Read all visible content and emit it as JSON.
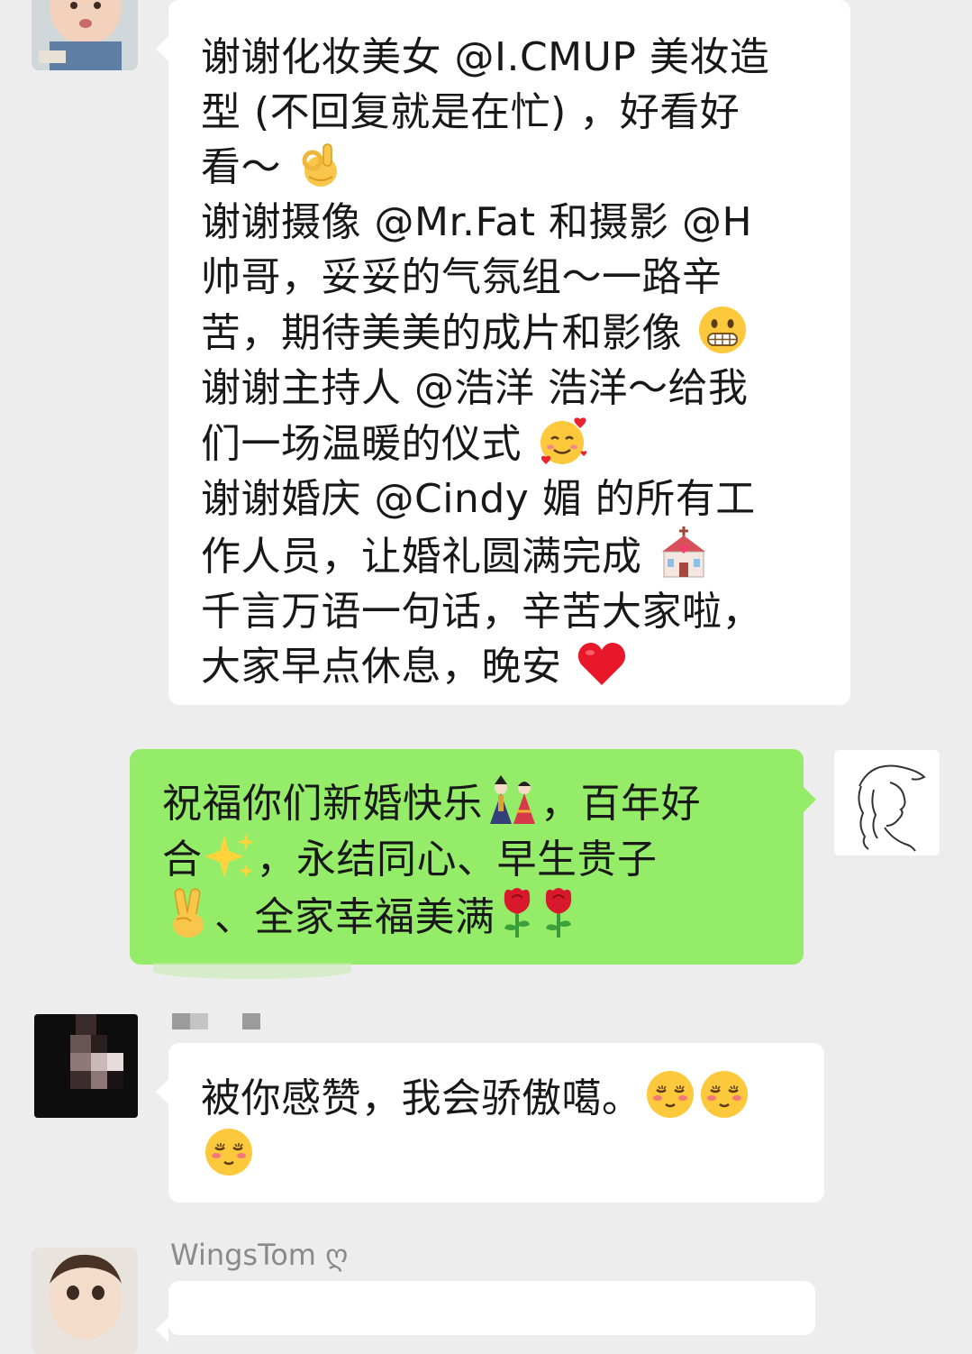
{
  "messages": [
    {
      "sender": "",
      "lines": [
        "谢谢化妆美女 @I.CMUP 美妆造",
        "型 (不回复就是在忙) ，好看好",
        "看～",
        "谢谢摄像 @Mr.Fat 和摄影 @H",
        "帅哥，妥妥的气氛组～一路辛",
        "苦，期待美美的成片和影像",
        "谢谢主持人 @浩洋 浩洋～给我",
        "们一场温暖的仪式",
        "谢谢婚庆 @Cindy 媚 的所有工",
        "作人员，让婚礼圆满完成",
        "千言万语一句话，辛苦大家啦，",
        "大家早点休息，晚安"
      ],
      "emojis": [
        "ok-hand-emoji",
        "grimacing-emoji",
        "smiling-hearts-emoji",
        "wedding-chapel-emoji",
        "red-heart-emoji"
      ]
    },
    {
      "sender": "me",
      "lines": [
        "祝福你们新婚快乐",
        "，百年好",
        "合",
        "，永结同心、早生贵子",
        "、全家幸福美满"
      ],
      "emojis": [
        "dolls-emoji",
        "sparkles-emoji",
        "victory-hand-emoji",
        "rose-emoji",
        "rose-emoji"
      ]
    },
    {
      "sender": "",
      "lines": [
        "被你感赞，我会骄傲噶。"
      ],
      "emojis": [
        "blushing-emoji",
        "blushing-emoji",
        "blushing-emoji"
      ]
    }
  ],
  "last_sender_name": "WingsTom",
  "last_sender_symbol": "ღ",
  "colors": {
    "background": "#ededed",
    "bubble_in": "#ffffff",
    "bubble_out": "#95ec69",
    "sender_name": "#8a8a8a"
  }
}
